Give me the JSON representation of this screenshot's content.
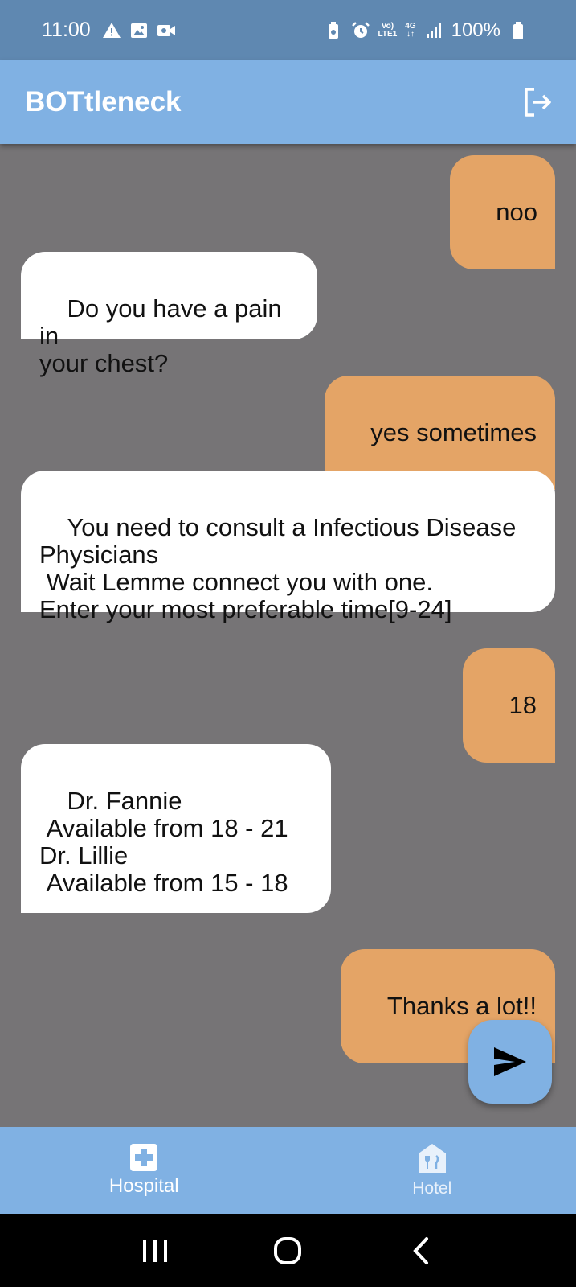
{
  "status_bar": {
    "time": "11:00",
    "network_top": "Vo)",
    "network_bottom": "LTE1",
    "network_gen": "4G",
    "battery": "100%"
  },
  "app_bar": {
    "title": "BOTtleneck",
    "logout_icon": "logout-icon"
  },
  "messages": [
    {
      "sender": "user",
      "text": "noo"
    },
    {
      "sender": "bot",
      "text": "Do you have a pain in\nyour chest?"
    },
    {
      "sender": "user",
      "text": "yes sometimes"
    },
    {
      "sender": "bot",
      "text": "You need to consult a Infectious Disease\nPhysicians\n Wait Lemme connect you with one.\nEnter your most preferable time[9-24]"
    },
    {
      "sender": "user",
      "text": "18"
    },
    {
      "sender": "bot",
      "text": "Dr. Fannie\n Available from 18 - 21\nDr. Lillie\n Available from 15 - 18\n"
    },
    {
      "sender": "user",
      "text": "Thanks a lot!!"
    }
  ],
  "fab": {
    "icon": "send-icon"
  },
  "bottom_nav": {
    "items": [
      {
        "label": "Hospital",
        "icon": "hospital-icon",
        "active": true
      },
      {
        "label": "Hotel",
        "icon": "hotel-icon",
        "active": false
      }
    ]
  },
  "colors": {
    "app_bar": "#80b1e3",
    "status_bar": "#5f88b1",
    "chat_background": "#767476",
    "user_bubble": "#e4a466",
    "bot_bubble": "#ffffff"
  }
}
